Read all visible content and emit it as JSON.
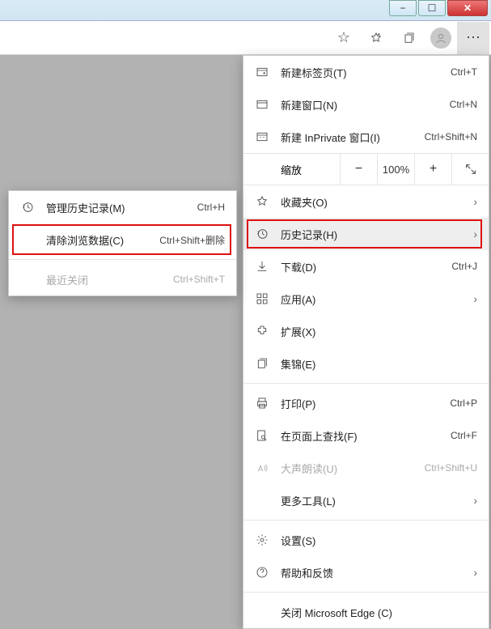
{
  "window": {
    "min": "—",
    "max": "▭",
    "close": "✕"
  },
  "toolbar": {
    "star": "☆",
    "star_add": "✩",
    "collections": "⧉",
    "more": "⋯"
  },
  "menu": {
    "new_tab": {
      "label": "新建标签页(T)",
      "shortcut": "Ctrl+T"
    },
    "new_window": {
      "label": "新建窗口(N)",
      "shortcut": "Ctrl+N"
    },
    "new_inprivate": {
      "label": "新建 InPrivate 窗口(I)",
      "shortcut": "Ctrl+Shift+N"
    },
    "zoom": {
      "label": "缩放",
      "value": "100%"
    },
    "favorites": {
      "label": "收藏夹(O)"
    },
    "history": {
      "label": "历史记录(H)"
    },
    "downloads": {
      "label": "下载(D)",
      "shortcut": "Ctrl+J"
    },
    "apps": {
      "label": "应用(A)"
    },
    "extensions": {
      "label": "扩展(X)"
    },
    "collections": {
      "label": "集锦(E)"
    },
    "print": {
      "label": "打印(P)",
      "shortcut": "Ctrl+P"
    },
    "find": {
      "label": "在页面上查找(F)",
      "shortcut": "Ctrl+F"
    },
    "read_aloud": {
      "label": "大声朗读(U)",
      "shortcut": "Ctrl+Shift+U"
    },
    "more_tools": {
      "label": "更多工具(L)"
    },
    "settings": {
      "label": "设置(S)"
    },
    "help": {
      "label": "帮助和反馈"
    },
    "close_edge": {
      "label": "关闭 Microsoft Edge (C)"
    }
  },
  "submenu": {
    "manage_history": {
      "label": "管理历史记录(M)",
      "shortcut": "Ctrl+H"
    },
    "clear_data": {
      "label": "清除浏览数据(C)",
      "shortcut": "Ctrl+Shift+删除"
    },
    "recent": {
      "label": "最近关闭",
      "shortcut": "Ctrl+Shift+T"
    }
  }
}
